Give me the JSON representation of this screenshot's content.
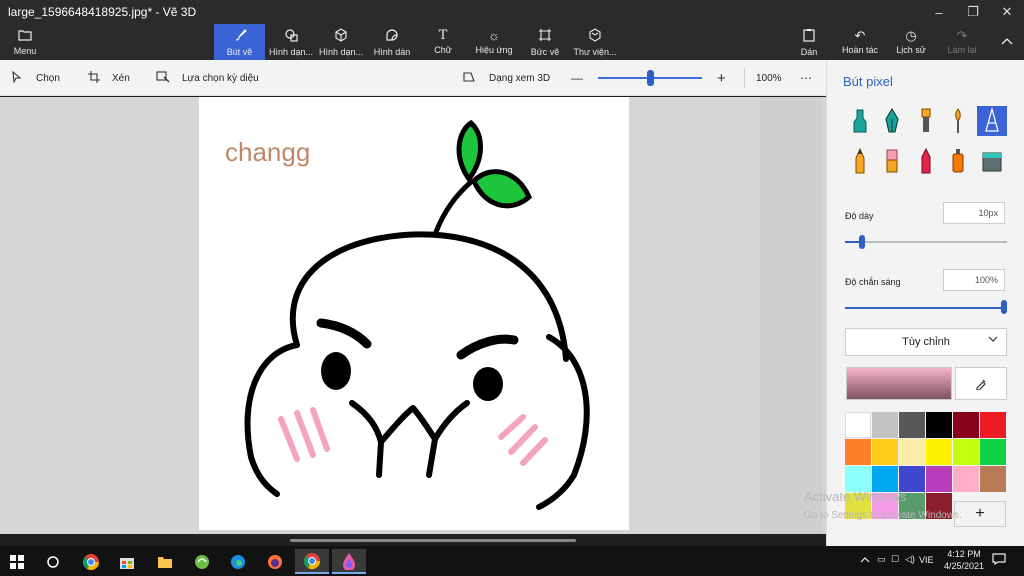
{
  "window": {
    "title": "large_1596648418925.jpg* - Vẽ 3D",
    "minimize_icon": "–",
    "maximize_icon": "❐",
    "close_icon": "✕"
  },
  "ribbon": {
    "menu": "Menu",
    "tabs": [
      "Bút vẽ",
      "Hình dạn...",
      "Hình dạn...",
      "Hình dán",
      "Chữ",
      "Hiệu ứng",
      "Bức vẽ",
      "Thư viện..."
    ],
    "paste": "Dán",
    "undo": "Hoàn tác",
    "history": "Lịch sử",
    "redo": "Làm lại"
  },
  "toolbar": {
    "select": "Chọn",
    "crop": "Xén",
    "magic_select": "Lựa chọn kỳ diệu",
    "view_3d": "Dạng xem 3D",
    "zoom_value": "100%",
    "zoom_fraction": 0.5
  },
  "canvas": {
    "text": "changg"
  },
  "panel": {
    "title": "Bút pixel",
    "thickness_label": "Độ dày",
    "thickness_value": "10px",
    "opacity_label": "Độ chắn sáng",
    "opacity_value": "100%",
    "dropdown": "Tùy chỉnh",
    "palette": [
      "#ffffff",
      "#c3c3c3",
      "#585858",
      "#000000",
      "#88001b",
      "#ec1c24",
      "#ff7f27",
      "#ffca18",
      "#fdeca6",
      "#fff200",
      "#c4ff0e",
      "#0ed145",
      "#8cfffb",
      "#00a8f3",
      "#3f48cc",
      "#b83dba",
      "#ffaec8",
      "#b97a56",
      "#e1e142",
      "#f59ce6",
      "#5a9b6b",
      "#8b1e2c"
    ]
  },
  "watermark": {
    "line1": "Activate Windows",
    "line2": "Go to Settings to activate Windows."
  },
  "taskbar": {
    "lang": "VIE",
    "time": "4:12 PM",
    "date": "4/25/2021"
  }
}
